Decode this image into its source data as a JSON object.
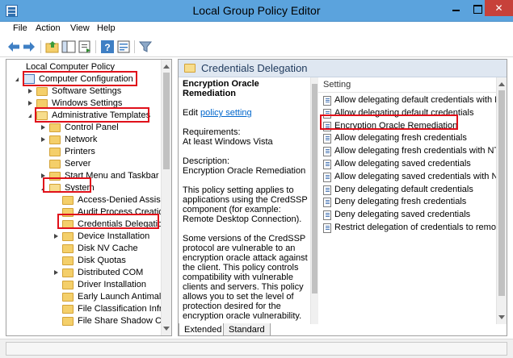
{
  "window": {
    "title": "Local Group Policy Editor",
    "close_glyph": "✕"
  },
  "menu": [
    "File",
    "Action",
    "View",
    "Help"
  ],
  "toolbar": {
    "icons": [
      "back-arrow-icon",
      "forward-arrow-icon",
      "up-folder-icon",
      "show-hide-tree-icon",
      "export-list-icon",
      "help-icon",
      "properties-icon",
      "filter-icon"
    ]
  },
  "tree": {
    "root": "Local Computer Policy",
    "items": [
      {
        "label": "Computer Configuration",
        "icon": "computer-icon",
        "expander": "open",
        "highlighted": true
      },
      {
        "label": "Software Settings",
        "icon": "folder-icon",
        "expander": "closed",
        "highlighted": false
      },
      {
        "label": "Windows Settings",
        "icon": "folder-icon",
        "expander": "closed",
        "highlighted": false
      },
      {
        "label": "Administrative Templates",
        "icon": "folder-icon",
        "expander": "open",
        "highlighted": true
      },
      {
        "label": "Control Panel",
        "icon": "folder-icon",
        "expander": "closed",
        "highlighted": false
      },
      {
        "label": "Network",
        "icon": "folder-icon",
        "expander": "closed",
        "highlighted": false
      },
      {
        "label": "Printers",
        "icon": "folder-icon",
        "expander": "none",
        "highlighted": false
      },
      {
        "label": "Server",
        "icon": "folder-icon",
        "expander": "none",
        "highlighted": false
      },
      {
        "label": "Start Menu and Taskbar",
        "icon": "folder-icon",
        "expander": "closed",
        "highlighted": false
      },
      {
        "label": "System",
        "icon": "folder-icon",
        "expander": "open",
        "highlighted": true
      },
      {
        "label": "Access-Denied Assistanc",
        "icon": "folder-icon",
        "expander": "none",
        "highlighted": false
      },
      {
        "label": "Audit Process Creation",
        "icon": "folder-icon",
        "expander": "none",
        "highlighted": false
      },
      {
        "label": "Credentials Delegation",
        "icon": "folder-icon",
        "expander": "none",
        "highlighted": true
      },
      {
        "label": "Device Installation",
        "icon": "folder-icon",
        "expander": "closed",
        "highlighted": false
      },
      {
        "label": "Disk NV Cache",
        "icon": "folder-icon",
        "expander": "none",
        "highlighted": false
      },
      {
        "label": "Disk Quotas",
        "icon": "folder-icon",
        "expander": "none",
        "highlighted": false
      },
      {
        "label": "Distributed COM",
        "icon": "folder-icon",
        "expander": "closed",
        "highlighted": false
      },
      {
        "label": "Driver Installation",
        "icon": "folder-icon",
        "expander": "none",
        "highlighted": false
      },
      {
        "label": "Early Launch Antimalwa",
        "icon": "folder-icon",
        "expander": "none",
        "highlighted": false
      },
      {
        "label": "File Classification Infrast",
        "icon": "folder-icon",
        "expander": "none",
        "highlighted": false
      },
      {
        "label": "File Share Shadow Copy",
        "icon": "folder-icon",
        "expander": "none",
        "highlighted": false
      }
    ]
  },
  "details": {
    "header_title": "Credentials Delegation",
    "policy_title": "Encryption Oracle Remediation",
    "edit_prefix": "Edit",
    "edit_link": "policy setting",
    "requirements_label": "Requirements:",
    "requirements_value": "At least Windows Vista",
    "description_label": "Description:",
    "description_value": "Encryption Oracle Remediation",
    "paragraph1": "This policy setting applies to applications using the CredSSP component (for example: Remote Desktop Connection).",
    "paragraph2": "Some versions of the CredSSP protocol are vulnerable to an encryption oracle attack against the client. This policy controls compatibility with vulnerable clients and servers. This policy allows you to set the level of protection desired for the encryption oracle vulnerability."
  },
  "settings": {
    "column_header": "Setting",
    "items": [
      {
        "label": "Allow delegating default credentials with NTLM-",
        "highlighted": false
      },
      {
        "label": "Allow delegating default credentials",
        "highlighted": false
      },
      {
        "label": "Encryption Oracle Remediation",
        "highlighted": true
      },
      {
        "label": "Allow delegating fresh credentials",
        "highlighted": false
      },
      {
        "label": "Allow delegating fresh credentials with NTLM-or",
        "highlighted": false
      },
      {
        "label": "Allow delegating saved credentials",
        "highlighted": false
      },
      {
        "label": "Allow delegating saved credentials with NTLM-c",
        "highlighted": false
      },
      {
        "label": "Deny delegating default credentials",
        "highlighted": false
      },
      {
        "label": "Deny delegating fresh credentials",
        "highlighted": false
      },
      {
        "label": "Deny delegating saved credentials",
        "highlighted": false
      },
      {
        "label": "Restrict delegation of credentials to remote serv",
        "highlighted": false
      }
    ]
  },
  "tabs": [
    "Extended",
    "Standard"
  ],
  "colors": {
    "titlebar": "#5ba3dd",
    "close_button": "#c7413a",
    "annotation": "#e0101a",
    "link": "#0066cc",
    "folder": "#f4cf6a"
  }
}
